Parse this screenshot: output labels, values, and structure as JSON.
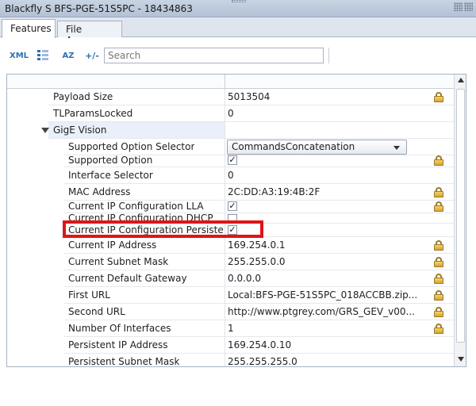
{
  "window": {
    "title": "Blackfly S BFS-PGE-51S5PC - 18434863"
  },
  "tabs": [
    {
      "label": "Features"
    },
    {
      "label": "File Access"
    }
  ],
  "toolbar": {
    "xml_label": "XML",
    "sort_label": "AZ",
    "expand_label": "+/-",
    "search_placeholder": "Search",
    "search_value": ""
  },
  "rows": [
    {
      "name": "Payload Size",
      "value": "5013504",
      "locked": true
    },
    {
      "name": "TLParamsLocked",
      "value": "0",
      "locked": false
    },
    {
      "name": "GigE Vision",
      "value": "",
      "group": true
    },
    {
      "name": "Supported Option Selector",
      "value": "CommandsConcatenation",
      "control": "select"
    },
    {
      "name": "Supported Option",
      "value": "✓",
      "control": "checkbox",
      "locked": true
    },
    {
      "name": "Interface Selector",
      "value": "0",
      "locked": false
    },
    {
      "name": "MAC Address",
      "value": "2C:DD:A3:19:4B:2F",
      "locked": true
    },
    {
      "name": "Current IP Configuration LLA",
      "value": "✓",
      "control": "checkbox",
      "locked": true
    },
    {
      "name": "Current IP Configuration DHCP",
      "value": "",
      "control": "checkbox",
      "locked": false
    },
    {
      "name": "Current IP Configuration Persiste…",
      "value": "✓",
      "control": "checkbox",
      "locked": false
    },
    {
      "name": "Current IP Address",
      "value": "169.254.0.1",
      "locked": true
    },
    {
      "name": "Current Subnet Mask",
      "value": "255.255.0.0",
      "locked": true
    },
    {
      "name": "Current Default Gateway",
      "value": "0.0.0.0",
      "locked": true
    },
    {
      "name": "First URL",
      "value": "Local:BFS-PGE-51S5PC_018ACCBB.zip...",
      "locked": true
    },
    {
      "name": "Second URL",
      "value": "http://www.ptgrey.com/GRS_GEV_v00...",
      "locked": true
    },
    {
      "name": "Number Of Interfaces",
      "value": "1",
      "locked": true
    },
    {
      "name": "Persistent IP Address",
      "value": "169.254.0.10",
      "locked": false
    },
    {
      "name": "Persistent Subnet Mask",
      "value": "255.255.255.0",
      "locked": false
    }
  ],
  "colors": {
    "highlight": "#e01515",
    "accent": "#2f6fb3",
    "lock": "#d4a532"
  }
}
